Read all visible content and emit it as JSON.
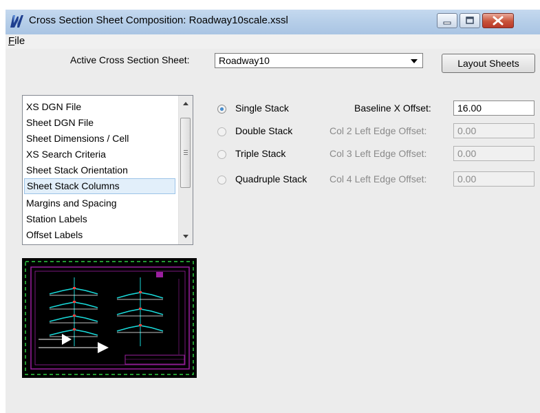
{
  "window": {
    "title": "Cross Section Sheet Composition: Roadway10scale.xssl",
    "app_icon": "microstation-icon",
    "minimize_icon": "minimize-icon",
    "maximize_icon": "maximize-icon",
    "close_icon": "close-icon",
    "close_color": "#c8533a"
  },
  "menu": {
    "file_accel": "F",
    "file_rest": "ile"
  },
  "active_sheet": {
    "label": "Active Cross Section Sheet:",
    "value": "Roadway10",
    "layout_button": "Layout Sheets"
  },
  "list": {
    "items": [
      "XS DGN File",
      "Sheet DGN File",
      "Sheet Dimensions / Cell",
      "XS Search Criteria",
      "Sheet Stack Orientation",
      "Sheet Stack Columns",
      "Margins and Spacing",
      "Station Labels",
      "Offset Labels"
    ],
    "selected": "Sheet Stack Columns"
  },
  "stack": {
    "options": [
      "Single Stack",
      "Double Stack",
      "Triple Stack",
      "Quadruple Stack"
    ],
    "selected": "Single Stack",
    "fields": [
      {
        "label": "Baseline X Offset:",
        "value": "16.00",
        "enabled": true
      },
      {
        "label": "Col 2 Left Edge Offset:",
        "value": "0.00",
        "enabled": false
      },
      {
        "label": "Col 3 Left Edge Offset:",
        "value": "0.00",
        "enabled": false
      },
      {
        "label": "Col 4 Left Edge Offset:",
        "value": "0.00",
        "enabled": false
      }
    ]
  },
  "preview": {
    "colors": {
      "background": "#000000",
      "sheet_border": "#9c1fa0",
      "outer_dash": "#2ecc40",
      "template": "#19d9d9",
      "baseline": "#ffffff",
      "marker": "#ff4040"
    }
  }
}
